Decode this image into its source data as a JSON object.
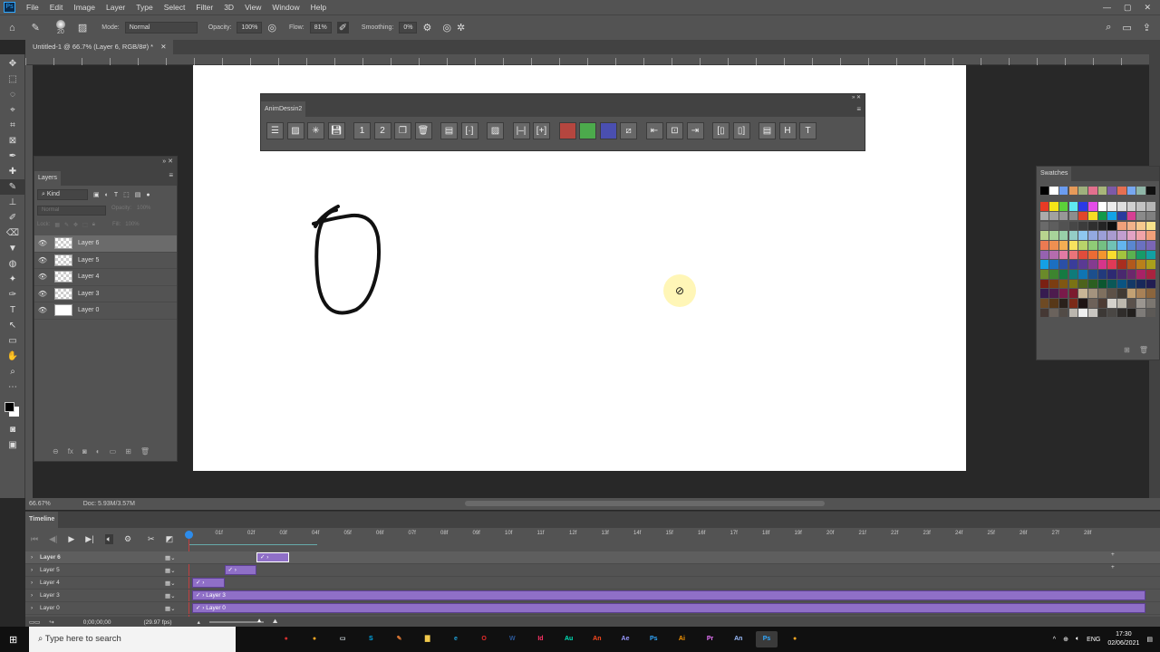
{
  "menu": {
    "items": [
      "File",
      "Edit",
      "Image",
      "Layer",
      "Type",
      "Select",
      "Filter",
      "3D",
      "View",
      "Window",
      "Help"
    ]
  },
  "options": {
    "brush_size": "20",
    "mode_label": "Mode:",
    "mode_value": "Normal",
    "opacity_label": "Opacity:",
    "opacity_value": "100%",
    "flow_label": "Flow:",
    "flow_value": "81%",
    "smoothing_label": "Smoothing:",
    "smoothing_value": "0%"
  },
  "document": {
    "tab_title": "Untitled-1 @ 66.7% (Layer 6, RGB/8#) *",
    "zoom": "66.67%",
    "doc_size": "Doc: 5.93M/3.57M"
  },
  "layers_panel": {
    "title": "Layers",
    "filter": "Kind",
    "blend_mode": "Normal",
    "opacity_label": "Opacity:",
    "opacity_value": "100%",
    "lock_label": "Lock:",
    "fill_label": "Fill:",
    "fill_value": "100%",
    "layers": [
      {
        "name": "Layer 6",
        "selected": true,
        "transparent": true
      },
      {
        "name": "Layer 5",
        "selected": false,
        "transparent": true
      },
      {
        "name": "Layer 4",
        "selected": false,
        "transparent": true
      },
      {
        "name": "Layer 3",
        "selected": false,
        "transparent": true
      },
      {
        "name": "Layer 0",
        "selected": false,
        "transparent": false
      }
    ]
  },
  "anim_panel": {
    "title": "AnimDessin2",
    "buttons": [
      "insert-frame",
      "onion-skin",
      "explode",
      "save",
      "new-1",
      "new-2",
      "duplicate",
      "delete",
      "copy-frames",
      "select-frame",
      "light-table",
      "extend",
      "add-frame",
      "red-frame",
      "green-frame",
      "blue-frame",
      "no-color",
      "move-left",
      "center",
      "move-right",
      "first-frame",
      "last-frame",
      "notes",
      "html-export",
      "text-export"
    ],
    "colors": {
      "red": "#b5463f",
      "green": "#4caa4c",
      "blue": "#4a4fb0"
    }
  },
  "swatches": {
    "title": "Swatches",
    "recent": [
      "#000000",
      "#ffffff",
      "#6b9cf0",
      "#e69a5a",
      "#9fb07d",
      "#e3708e",
      "#a8b57a",
      "#7d5aa8",
      "#e56f52",
      "#77a7f0",
      "#8fb6a8",
      "#111111"
    ],
    "rows": [
      [
        "#e83a25",
        "#f5e617",
        "#5cd13a",
        "#5fe8f0",
        "#2a3ae6",
        "#e44de8",
        "#ffffff",
        "#ececec",
        "#dedede",
        "#d0d0d0",
        "#c2c2c2",
        "#b5b5b5"
      ],
      [
        "#ababab",
        "#a1a1a1",
        "#979797",
        "#8d8d8d",
        "#e0452b",
        "#f7dc23",
        "#119a4a",
        "#12a3e6",
        "#2a3b9e",
        "#d63e93",
        "#8a8a8a",
        "#808080"
      ],
      [
        "#6a6a6a",
        "#5e5e5e",
        "#525252",
        "#474747",
        "#3c3c3c",
        "#2f2f2f",
        "#242424",
        "#0f0f0f",
        "#f0a07a",
        "#f2b28a",
        "#f6c98e",
        "#f7e28b"
      ],
      [
        "#b8d48e",
        "#a7d39a",
        "#98cfa8",
        "#94cdc6",
        "#8ec7ef",
        "#93a9e0",
        "#9c9fd8",
        "#a99bd0",
        "#c19ed0",
        "#e2a2c4",
        "#f0a3a8",
        "#f0a07a"
      ],
      [
        "#ec7a52",
        "#ef8f51",
        "#f4ad53",
        "#f8e35e",
        "#b8d36a",
        "#8fcb76",
        "#74c083",
        "#70c2b4",
        "#63b5ee",
        "#5a87d0",
        "#6a71c0",
        "#7a66b5"
      ],
      [
        "#9662b0",
        "#b56cae",
        "#e07aa4",
        "#e9747a",
        "#e04c3c",
        "#ec6b34",
        "#f3952f",
        "#f8dc2e",
        "#a2c43e",
        "#5bb150",
        "#179b68",
        "#12a0a3"
      ],
      [
        "#14a0e6",
        "#1c6fc1",
        "#2b4fa6",
        "#3a3d9a",
        "#5a3a93",
        "#843b8f",
        "#d6358a",
        "#e03a57",
        "#a82e1f",
        "#b2591c",
        "#b9801b",
        "#a99f1b"
      ],
      [
        "#6a8a2a",
        "#3d842f",
        "#157a42",
        "#0f7b7a",
        "#0f75b3",
        "#1c4f8d",
        "#223a7c",
        "#2d2a72",
        "#49286e",
        "#6b286b",
        "#a82266",
        "#a9233f"
      ],
      [
        "#7a2013",
        "#7b3d12",
        "#805712",
        "#7a7314",
        "#4c631c",
        "#2b5f21",
        "#0b5730",
        "#0a5857",
        "#0a5482",
        "#133866",
        "#18285a",
        "#211d52"
      ],
      [
        "#361c50",
        "#4d1c4e",
        "#7a1a4a",
        "#7c1a2e",
        "#c9b596",
        "#a4937e",
        "#7f705f",
        "#5d5147",
        "#413a33",
        "#c2a174",
        "#a88157",
        "#8b653d"
      ],
      [
        "#6e4a24",
        "#573818",
        "#2a211b",
        "#7b2a18",
        "#1e1414",
        "#6d6159",
        "#4d3c34",
        "#d5d2cc",
        "#bdb8ae",
        "#5a514b",
        "#9b9690",
        "#7b7670"
      ],
      [
        "#453834",
        "#6a625c",
        "#524b46",
        "#bbb6ae",
        "#efefef",
        "#c8c5c0",
        "#3c3835",
        "#4a4744",
        "#302d2b",
        "#221f1d",
        "#7e7b78",
        "#5c5956"
      ]
    ]
  },
  "timeline": {
    "title": "Timeline",
    "timecode": "0;00;00;00",
    "fps": "(29.97 fps)",
    "ruler": [
      "01f",
      "02f",
      "03f",
      "04f",
      "05f",
      "06f",
      "07f",
      "08f",
      "09f",
      "10f",
      "11f",
      "12f",
      "13f",
      "14f",
      "15f",
      "16f",
      "17f",
      "18f",
      "19f",
      "20f",
      "21f",
      "22f",
      "23f",
      "24f",
      "25f",
      "26f",
      "27f",
      "28f"
    ],
    "tracks": [
      {
        "name": "Layer 6",
        "clip_label": "",
        "clip_start_frame": 2,
        "clip_end_frame": 3,
        "selected": true
      },
      {
        "name": "Layer 5",
        "clip_label": "",
        "clip_start_frame": 1,
        "clip_end_frame": 2
      },
      {
        "name": "Layer 4",
        "clip_label": "",
        "clip_start_frame": 0,
        "clip_end_frame": 1
      },
      {
        "name": "Layer 3",
        "clip_label": "Layer 3",
        "clip_start_frame": 0,
        "clip_end_frame": 30
      },
      {
        "name": "Layer 0",
        "clip_label": "Layer 0",
        "clip_start_frame": 0,
        "clip_end_frame": 30
      }
    ],
    "clip_color": "#8f6fc7"
  },
  "taskbar": {
    "search_placeholder": "Type here to search",
    "apps": [
      {
        "label": "",
        "color": "#f3c24b"
      },
      {
        "label": "●",
        "color": "#d32f2f"
      },
      {
        "label": "●",
        "color": "#f5a623"
      },
      {
        "label": "▭",
        "color": "#cfd8dc"
      },
      {
        "label": "S",
        "color": "#00aff0"
      },
      {
        "label": "✎",
        "color": "#e57c36"
      },
      {
        "label": "▇",
        "color": "#f2c94c"
      },
      {
        "label": "e",
        "color": "#1fa0d8"
      },
      {
        "label": "O",
        "color": "#e52b2b"
      },
      {
        "label": "W",
        "color": "#2b5797"
      },
      {
        "label": "Id",
        "color": "#ff3366"
      },
      {
        "label": "Au",
        "color": "#00e4bb"
      },
      {
        "label": "An",
        "color": "#ff4a1f"
      },
      {
        "label": "Ae",
        "color": "#9999ff"
      },
      {
        "label": "Ps",
        "color": "#31a8ff"
      },
      {
        "label": "Ai",
        "color": "#ff9a00"
      },
      {
        "label": "Pr",
        "color": "#ea77ff"
      },
      {
        "label": "An",
        "color": "#9cbefe"
      },
      {
        "label": "Ps",
        "color": "#31a8ff"
      },
      {
        "label": "●",
        "color": "#f5a623"
      }
    ],
    "tray": {
      "language": "ENG",
      "time": "17:30",
      "date": "02/06/2021"
    }
  }
}
